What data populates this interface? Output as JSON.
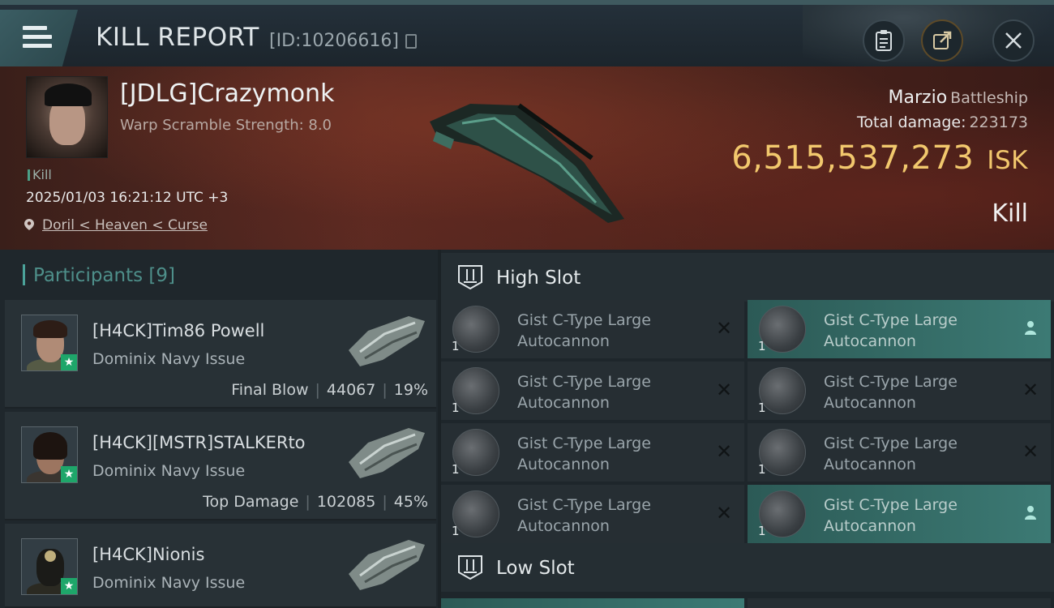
{
  "header": {
    "title": "KILL REPORT",
    "report_id": "[ID:10206616]"
  },
  "victim": {
    "name": "[JDLG]Crazymonk",
    "warp_scramble": "Warp Scramble Strength: 8.0",
    "tag": "Kill",
    "datetime": "2025/01/03 16:21:12 UTC +3",
    "location": "Doril < Heaven < Curse",
    "ship_name": "Marzio",
    "ship_class": "Battleship",
    "total_damage_label": "Total damage:",
    "total_damage": "223173",
    "isk_value": "6,515,537,273",
    "isk_unit": "ISK",
    "result": "Kill"
  },
  "participants": {
    "title": "Participants [9]",
    "items": [
      {
        "name": "[H4CK]Tim86 Powell",
        "ship": "Dominix Navy Issue",
        "stat_label": "Final Blow",
        "damage": "44067",
        "percent": "19%"
      },
      {
        "name": "[H4CK][MSTR]STALKERto",
        "ship": "Dominix Navy Issue",
        "stat_label": "Top Damage",
        "damage": "102085",
        "percent": "45%"
      },
      {
        "name": "[H4CK]Nionis",
        "ship": "Dominix Navy Issue",
        "stat_label": "",
        "damage": "",
        "percent": ""
      }
    ]
  },
  "slots": {
    "high_label": "High Slot",
    "low_label": "Low Slot",
    "high_modules": [
      {
        "line1": "Gist C-Type Large",
        "line2": "Autocannon",
        "qty": "1",
        "status": "destroyed"
      },
      {
        "line1": "Gist C-Type Large",
        "line2": "Autocannon",
        "qty": "1",
        "status": "dropped"
      },
      {
        "line1": "Gist C-Type Large",
        "line2": "Autocannon",
        "qty": "1",
        "status": "destroyed"
      },
      {
        "line1": "Gist C-Type Large",
        "line2": "Autocannon",
        "qty": "1",
        "status": "destroyed"
      },
      {
        "line1": "Gist C-Type Large",
        "line2": "Autocannon",
        "qty": "1",
        "status": "destroyed"
      },
      {
        "line1": "Gist C-Type Large",
        "line2": "Autocannon",
        "qty": "1",
        "status": "destroyed"
      },
      {
        "line1": "Gist C-Type Large",
        "line2": "Autocannon",
        "qty": "1",
        "status": "destroyed"
      },
      {
        "line1": "Gist C-Type Large",
        "line2": "Autocannon",
        "qty": "1",
        "status": "dropped"
      }
    ]
  },
  "colors": {
    "accent": "#4ba39a",
    "isk": "#f2c86d",
    "highlight": "#3c7a74"
  }
}
